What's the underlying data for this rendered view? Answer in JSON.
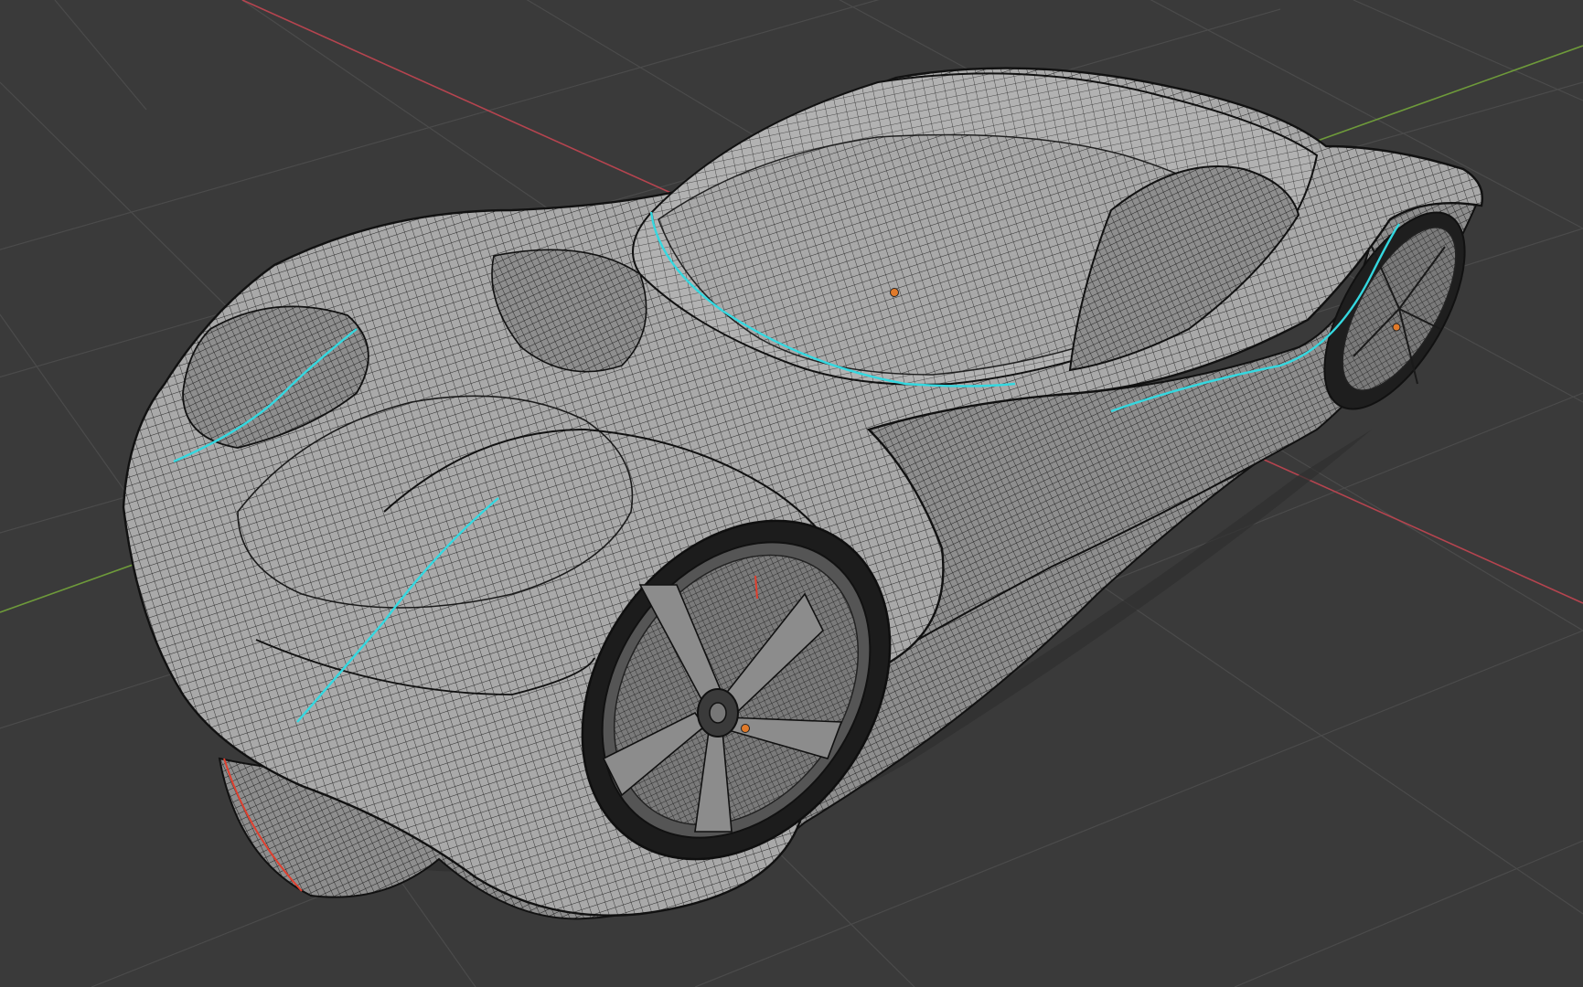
{
  "viewport": {
    "mode": "3D Viewport",
    "shading": "wireframe-overlay",
    "colors": {
      "background": "#3a3a3a",
      "grid": "#4a4a4a",
      "x_axis": "#b5444f",
      "y_axis": "#6e9a3a",
      "mesh_fill": "#a7a7a7",
      "mesh_wire": "#1e1e1e",
      "seam": "#35d8e0",
      "sharp_edge": "#e0402f",
      "origin_point": "#e07a2a"
    }
  },
  "scene": {
    "object": "car-body-mesh",
    "objects": [
      "body",
      "front-wheel",
      "rear-wheel"
    ],
    "origins_shown": 3
  }
}
